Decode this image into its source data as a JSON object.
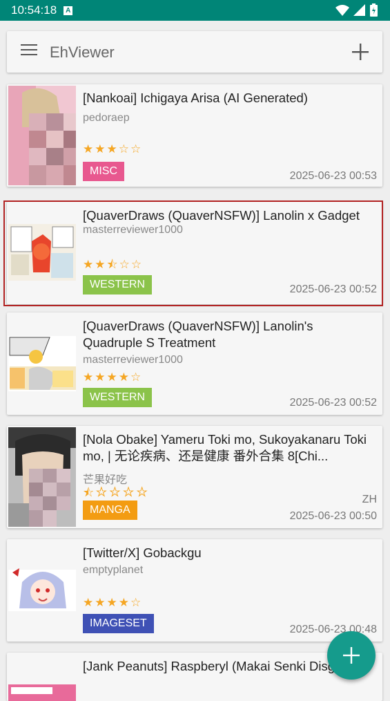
{
  "status_bar": {
    "time": "10:54:18",
    "notif_glyph": "A"
  },
  "search_bar": {
    "title": "EhViewer"
  },
  "galleries": [
    {
      "title": "[Nankoai] Ichigaya Arisa (AI Generated)",
      "uploader": "pedoraep",
      "stars": "★★★☆☆",
      "rating": 3.0,
      "category": "MISC",
      "category_color": "#e8588f",
      "date": "2025-06-23 00:53",
      "language": ""
    },
    {
      "title": "[QuaverDraws (QuaverNSFW)] Lanolin x Gadget",
      "uploader": "masterreviewer1000",
      "stars": "★★⯪☆☆",
      "rating": 2.5,
      "category": "WESTERN",
      "category_color": "#8bc34a",
      "date": "2025-06-23 00:52",
      "language": ""
    },
    {
      "title": "[QuaverDraws (QuaverNSFW)] Lanolin's Quadruple S Treatment",
      "uploader": "masterreviewer1000",
      "stars": "★★★★☆",
      "rating": 4.0,
      "category": "WESTERN",
      "category_color": "#8bc34a",
      "date": "2025-06-23 00:52",
      "language": ""
    },
    {
      "title": "[Nola Obake] Yameru Toki mo, Sukoyakanaru Toki mo, | 无论疾病、还是健康 番外合集 8[Chi...",
      "uploader": "芒果好吃",
      "stars": "⯪☆☆☆☆",
      "rating": 0.5,
      "category": "MANGA",
      "category_color": "#f39c12",
      "date": "2025-06-23 00:50",
      "language": "ZH"
    },
    {
      "title": "[Twitter/X] Gobackgu",
      "uploader": "emptyplanet",
      "stars": "★★★★☆",
      "rating": 4.0,
      "category": "IMAGESET",
      "category_color": "#3f51b5",
      "date": "2025-06-23 00:48",
      "language": ""
    },
    {
      "title": "[Jank Peanuts] Raspberyl (Makai Senki Disgaea)",
      "uploader": "",
      "stars": "",
      "category": "",
      "date": "",
      "language": ""
    }
  ],
  "icons": {
    "menu": "hamburger-icon",
    "add": "plus-icon",
    "fab": "plus-icon"
  },
  "colors": {
    "status_bar": "#008577",
    "fab": "#159b8c",
    "selection_border": "#b22222"
  }
}
